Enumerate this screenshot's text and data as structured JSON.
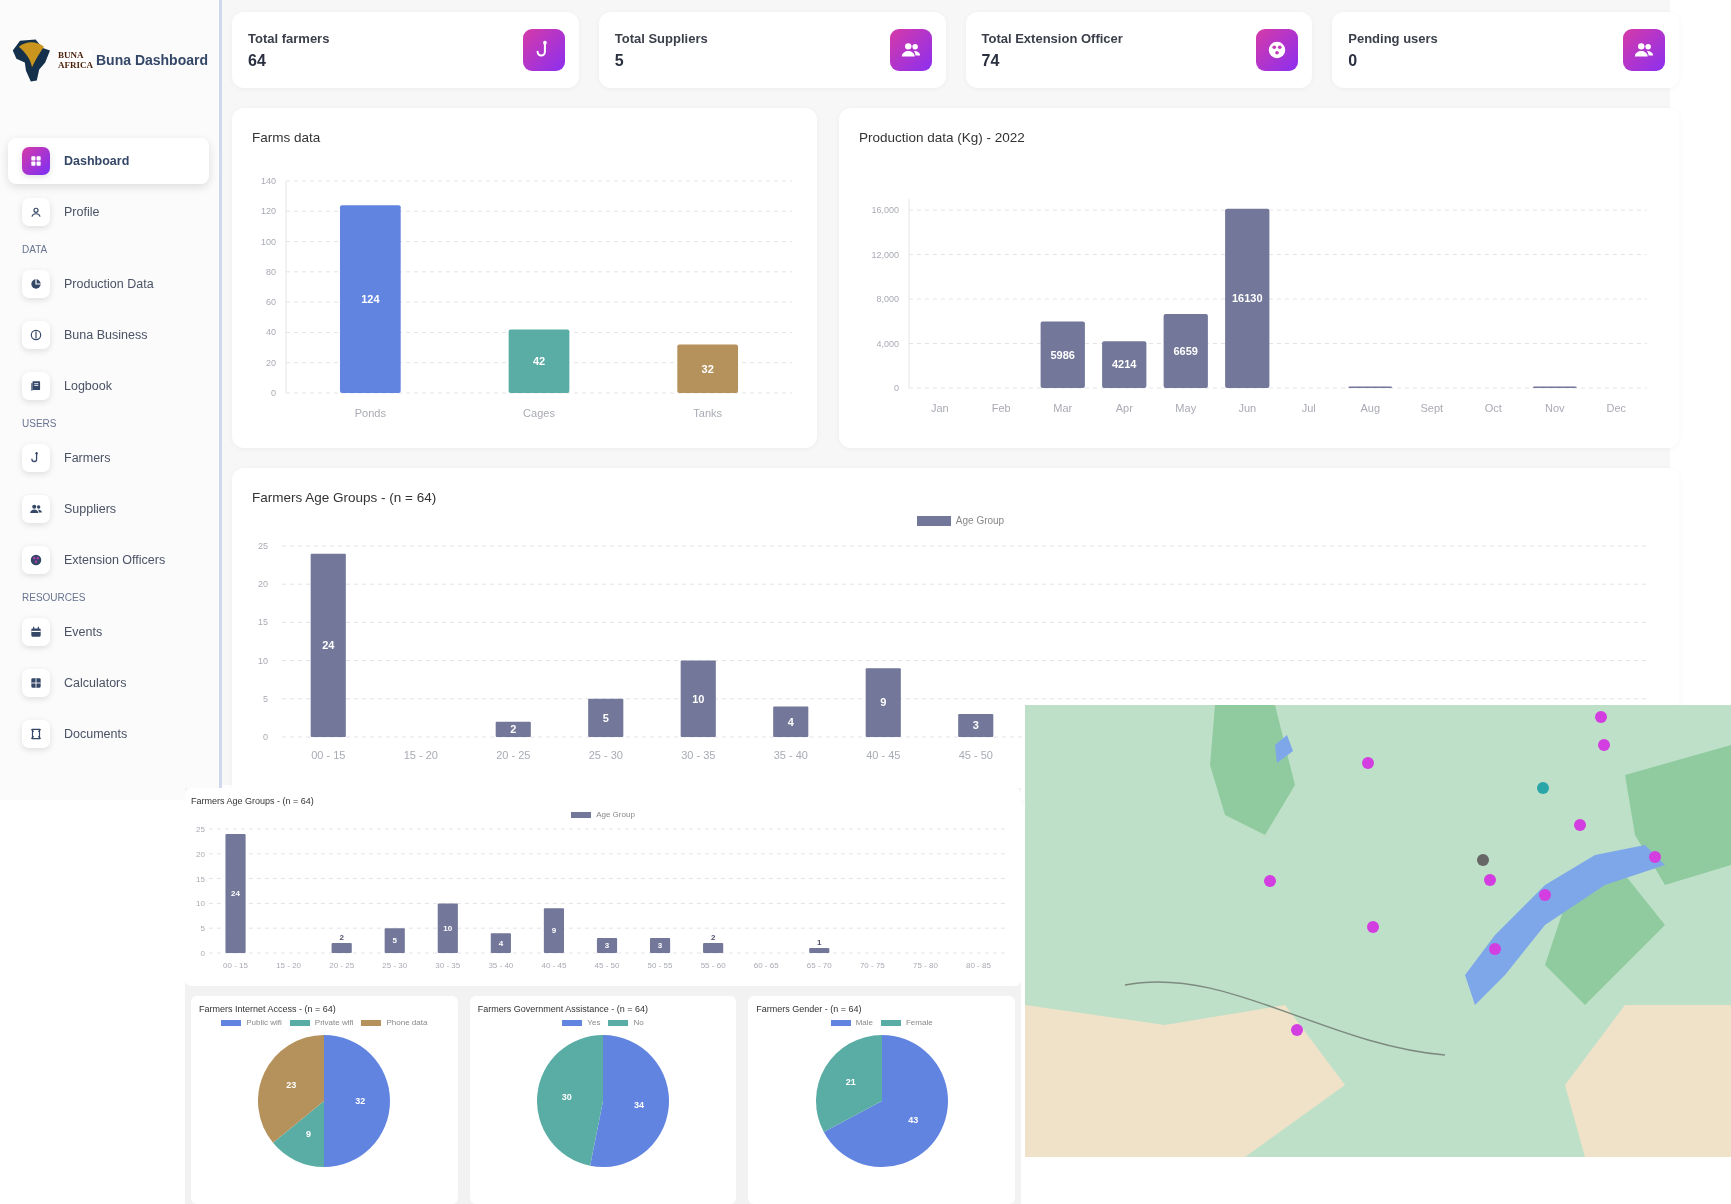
{
  "sidebar": {
    "logo_text": "BUNA AFRICA",
    "brand": "Buna Dashboard",
    "top_items": [
      {
        "label": "Dashboard",
        "selected": true
      },
      {
        "label": "Profile",
        "selected": false
      }
    ],
    "sections": [
      {
        "heading": "DATA",
        "items": [
          {
            "label": "Production Data",
            "selected": false
          },
          {
            "label": "Buna Business",
            "selected": false
          },
          {
            "label": "Logbook",
            "selected": false
          }
        ]
      },
      {
        "heading": "USERS",
        "items": [
          {
            "label": "Farmers",
            "selected": false
          },
          {
            "label": "Suppliers",
            "selected": false
          },
          {
            "label": "Extension Officers",
            "selected": false
          }
        ]
      },
      {
        "heading": "RESOURCES",
        "items": [
          {
            "label": "Events",
            "selected": false
          },
          {
            "label": "Calculators",
            "selected": false
          },
          {
            "label": "Documents",
            "selected": false
          }
        ]
      }
    ]
  },
  "stat_cards": [
    {
      "label": "Total farmers",
      "value": "64"
    },
    {
      "label": "Total Suppliers",
      "value": "5"
    },
    {
      "label": "Total Extension Officer",
      "value": "74"
    },
    {
      "label": "Pending users",
      "value": "0"
    }
  ],
  "farms_chart": {
    "title": "Farms data",
    "chart_data": {
      "type": "bar",
      "categories": [
        "Ponds",
        "Cages",
        "Tanks"
      ],
      "series": [
        {
          "values": [
            124,
            42,
            32
          ]
        }
      ],
      "colors": [
        "#6184e0",
        "#5aada5",
        "#b5925c"
      ],
      "ylim": [
        0,
        140
      ],
      "yticks": [
        0,
        20,
        40,
        60,
        80,
        100,
        120,
        140
      ],
      "grid": true,
      "value_labels": [
        "124",
        "42",
        "32"
      ]
    }
  },
  "production_chart": {
    "title": "Production data (Kg) - 2022",
    "chart_data": {
      "type": "bar",
      "categories": [
        "Jan",
        "Feb",
        "Mar",
        "Apr",
        "May",
        "Jun",
        "Jul",
        "Aug",
        "Sept",
        "Oct",
        "Nov",
        "Dec"
      ],
      "series": [
        {
          "color": "#737799",
          "values": [
            0,
            0,
            5986,
            4214,
            6659,
            16130,
            0,
            100,
            0,
            0,
            100,
            0
          ]
        }
      ],
      "ylim": [
        0,
        17000
      ],
      "yticks": [
        0,
        {
          "value": 4000,
          "label": "4,000"
        },
        {
          "value": 8000,
          "label": "8,000"
        },
        {
          "value": 12000,
          "label": "12,000"
        },
        {
          "value": 16000,
          "label": "16,000"
        }
      ],
      "grid": true,
      "value_labels": [
        null,
        null,
        "5986",
        "4214",
        "6659",
        "16130",
        null,
        null,
        null,
        null,
        null,
        null
      ]
    }
  },
  "age_chart": {
    "title": "Farmers Age Groups - (n = 64)",
    "chart_data": {
      "type": "bar",
      "categories": [
        "00 - 15",
        "15 - 20",
        "20 - 25",
        "25 - 30",
        "30 - 35",
        "35 - 40",
        "40 - 45",
        "45 - 50"
      ],
      "series": [
        {
          "name": "Age Group",
          "color": "#737799",
          "values": [
            24,
            0,
            2,
            5,
            10,
            4,
            9,
            3
          ]
        }
      ],
      "ylim": [
        0,
        25
      ],
      "yticks": [
        0,
        5,
        10,
        15,
        20,
        25
      ],
      "grid": true,
      "value_labels": [
        "24",
        null,
        "2",
        "5",
        "10",
        "4",
        "9",
        "3"
      ]
    }
  },
  "second_view": {
    "age_chart": {
      "title": "Farmers Age Groups - (n = 64)",
      "chart_data": {
        "type": "bar",
        "categories": [
          "00 - 15",
          "15 - 20",
          "20 - 25",
          "25 - 30",
          "30 - 35",
          "35 - 40",
          "40 - 45",
          "45 - 50",
          "50 - 55",
          "55 - 60",
          "60 - 65",
          "65 - 70",
          "70 - 75",
          "75 - 80",
          "80 - 85"
        ],
        "series": [
          {
            "name": "Age Group",
            "color": "#737799",
            "values": [
              24,
              0,
              2,
              5,
              10,
              4,
              9,
              3,
              3,
              2,
              0,
              1,
              0,
              0,
              0
            ]
          }
        ],
        "ylim": [
          0,
          25
        ],
        "yticks": [
          0,
          5,
          10,
          15,
          20,
          25
        ],
        "grid": true,
        "value_labels": [
          "24",
          null,
          "2",
          "5",
          "10",
          "4",
          "9",
          "3",
          "3",
          "2",
          null,
          "1",
          null,
          null,
          null
        ]
      }
    },
    "pie_charts": [
      {
        "title": "Farmers Internet Access - (n = 64)",
        "chart_data": {
          "type": "pie",
          "categories": [
            "Public wifi",
            "Private wifi",
            "Phone data"
          ],
          "series": [
            {
              "values": [
                32,
                9,
                23
              ]
            }
          ],
          "colors": [
            "#6184e0",
            "#5aada5",
            "#b5925c"
          ],
          "data_labels": true
        }
      },
      {
        "title": "Farmers Government Assistance - (n = 64)",
        "chart_data": {
          "type": "pie",
          "categories": [
            "Yes",
            "No"
          ],
          "series": [
            {
              "values": [
                34,
                30
              ]
            }
          ],
          "colors": [
            "#6184e0",
            "#5aada5"
          ],
          "data_labels": true
        }
      },
      {
        "title": "Farmers Gender - (n = 64)",
        "chart_data": {
          "type": "pie",
          "categories": [
            "Male",
            "Female"
          ],
          "series": [
            {
              "values": [
                43,
                21
              ]
            }
          ],
          "colors": [
            "#6184e0",
            "#5aada5"
          ],
          "data_labels": true
        }
      }
    ]
  }
}
